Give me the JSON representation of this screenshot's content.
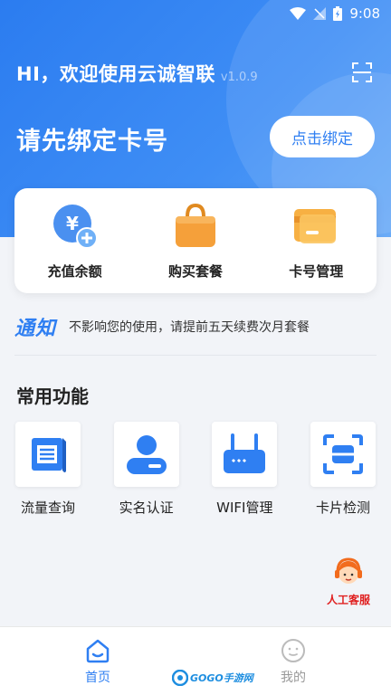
{
  "status_bar": {
    "time": "9:08"
  },
  "header": {
    "welcome": "HI，欢迎使用云诚智联",
    "version": "v1.0.9",
    "bind_prompt": "请先绑定卡号",
    "bind_button": "点击绑定"
  },
  "quick_actions": [
    {
      "label": "充值余额",
      "icon": "recharge-icon"
    },
    {
      "label": "购买套餐",
      "icon": "shopping-bag-icon"
    },
    {
      "label": "卡号管理",
      "icon": "card-icon"
    }
  ],
  "notice": {
    "tag": "通知",
    "text": "不影响您的使用，请提前五天续费次月套餐"
  },
  "functions": {
    "title": "常用功能",
    "items": [
      {
        "label": "流量查询",
        "icon": "document-icon"
      },
      {
        "label": "实名认证",
        "icon": "user-icon"
      },
      {
        "label": "WIFI管理",
        "icon": "router-icon"
      },
      {
        "label": "卡片检测",
        "icon": "scan-card-icon"
      }
    ]
  },
  "customer_service": {
    "label": "人工客服"
  },
  "tabs": [
    {
      "label": "首页",
      "icon": "home-icon",
      "active": true
    },
    {
      "label": "我的",
      "icon": "profile-icon",
      "active": false
    }
  ],
  "watermark": {
    "text": "GOGO手游网"
  },
  "colors": {
    "primary": "#2f7ff2",
    "accent_orange": "#f5a03a",
    "service_red": "#e02020"
  }
}
